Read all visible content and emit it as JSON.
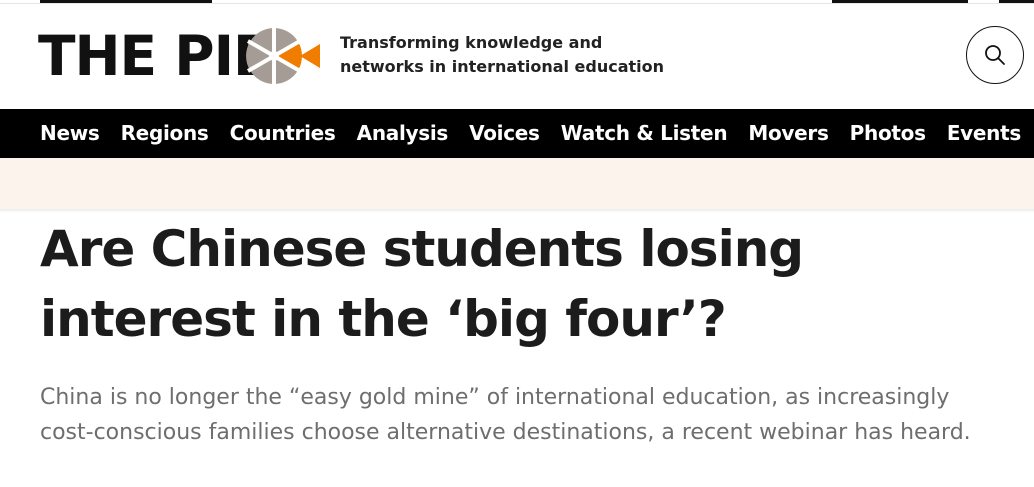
{
  "site": {
    "logo_text": "THE PIE",
    "tagline": "Transforming knowledge and networks in international education",
    "colors": {
      "accent": "#f07d00",
      "logo_gray": "#a59d95",
      "nav_bg": "#000000",
      "banner_bg": "#fcf4ec"
    }
  },
  "search": {
    "icon": "search-icon"
  },
  "nav": {
    "items": [
      {
        "label": "News"
      },
      {
        "label": "Regions"
      },
      {
        "label": "Countries"
      },
      {
        "label": "Analysis"
      },
      {
        "label": "Voices"
      },
      {
        "label": "Watch & Listen"
      },
      {
        "label": "Movers"
      },
      {
        "label": "Photos"
      },
      {
        "label": "Events"
      }
    ]
  },
  "article": {
    "headline": "Are Chinese students losing interest in the ‘big four’?",
    "standfirst": "China is no longer the “easy gold mine” of international education, as increasingly cost-conscious families choose alternative destinations, a recent webinar has heard."
  }
}
